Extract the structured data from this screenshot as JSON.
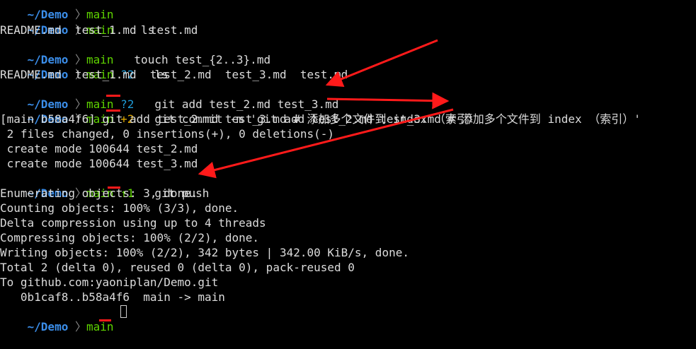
{
  "prompt": {
    "dir": "~/Demo",
    "branch": "main"
  },
  "lines": {
    "l0": {
      "status": "",
      "cmd": "main"
    },
    "l1": {
      "status": "",
      "cmd": "ls"
    },
    "l2": {
      "text": "README.md  test_1.md  test.md"
    },
    "l3": {
      "status": "",
      "cmd": "touch test_{2..3}.md"
    },
    "l4": {
      "status": "?2",
      "cmd": "ls"
    },
    "l5": {
      "text": "README.md  test_1.md  test_2.md  test_3.md  test.md"
    },
    "l6": {
      "status": "?2",
      "cmd": "git add test_2.md test_3.md"
    },
    "l7": {
      "status": "+2",
      "cmd": "git commit -m 'git add test_2.md test_3.md # 添加多个文件到 index （索引）'"
    },
    "l8": {
      "text": "[main b58a4f6] git add test_2.md test_3.md # 添加多个文件到 index （索引）"
    },
    "l9": {
      "text": " 2 files changed, 0 insertions(+), 0 deletions(-)"
    },
    "l10": {
      "text": " create mode 100644 test_2.md"
    },
    "l11": {
      "text": " create mode 100644 test_3.md"
    },
    "l12": {
      "status": "↑1",
      "cmd": "git push"
    },
    "l13": {
      "text": "Enumerating objects: 3, done."
    },
    "l14": {
      "text": "Counting objects: 100% (3/3), done."
    },
    "l15": {
      "text": "Delta compression using up to 4 threads"
    },
    "l16": {
      "text": "Compressing objects: 100% (2/2), done."
    },
    "l17": {
      "text": "Writing objects: 100% (2/2), 342 bytes | 342.00 KiB/s, done."
    },
    "l18": {
      "text": "Total 2 (delta 0), reused 0 (delta 0), pack-reused 0"
    },
    "l19": {
      "text": "To github.com:yaoniplan/Demo.git"
    },
    "l20": {
      "text": "   0b1caf8..b58a4f6  main -> main"
    },
    "l21": {
      "status": "",
      "cmd": ""
    }
  },
  "colors": {
    "background": "#000000",
    "dir": "#3b8eea",
    "branch": "#5fd400",
    "untracked": "#1e9bd7",
    "staged": "#e0a800",
    "ahead": "#5fd400",
    "annotation": "#ff1a1a"
  }
}
